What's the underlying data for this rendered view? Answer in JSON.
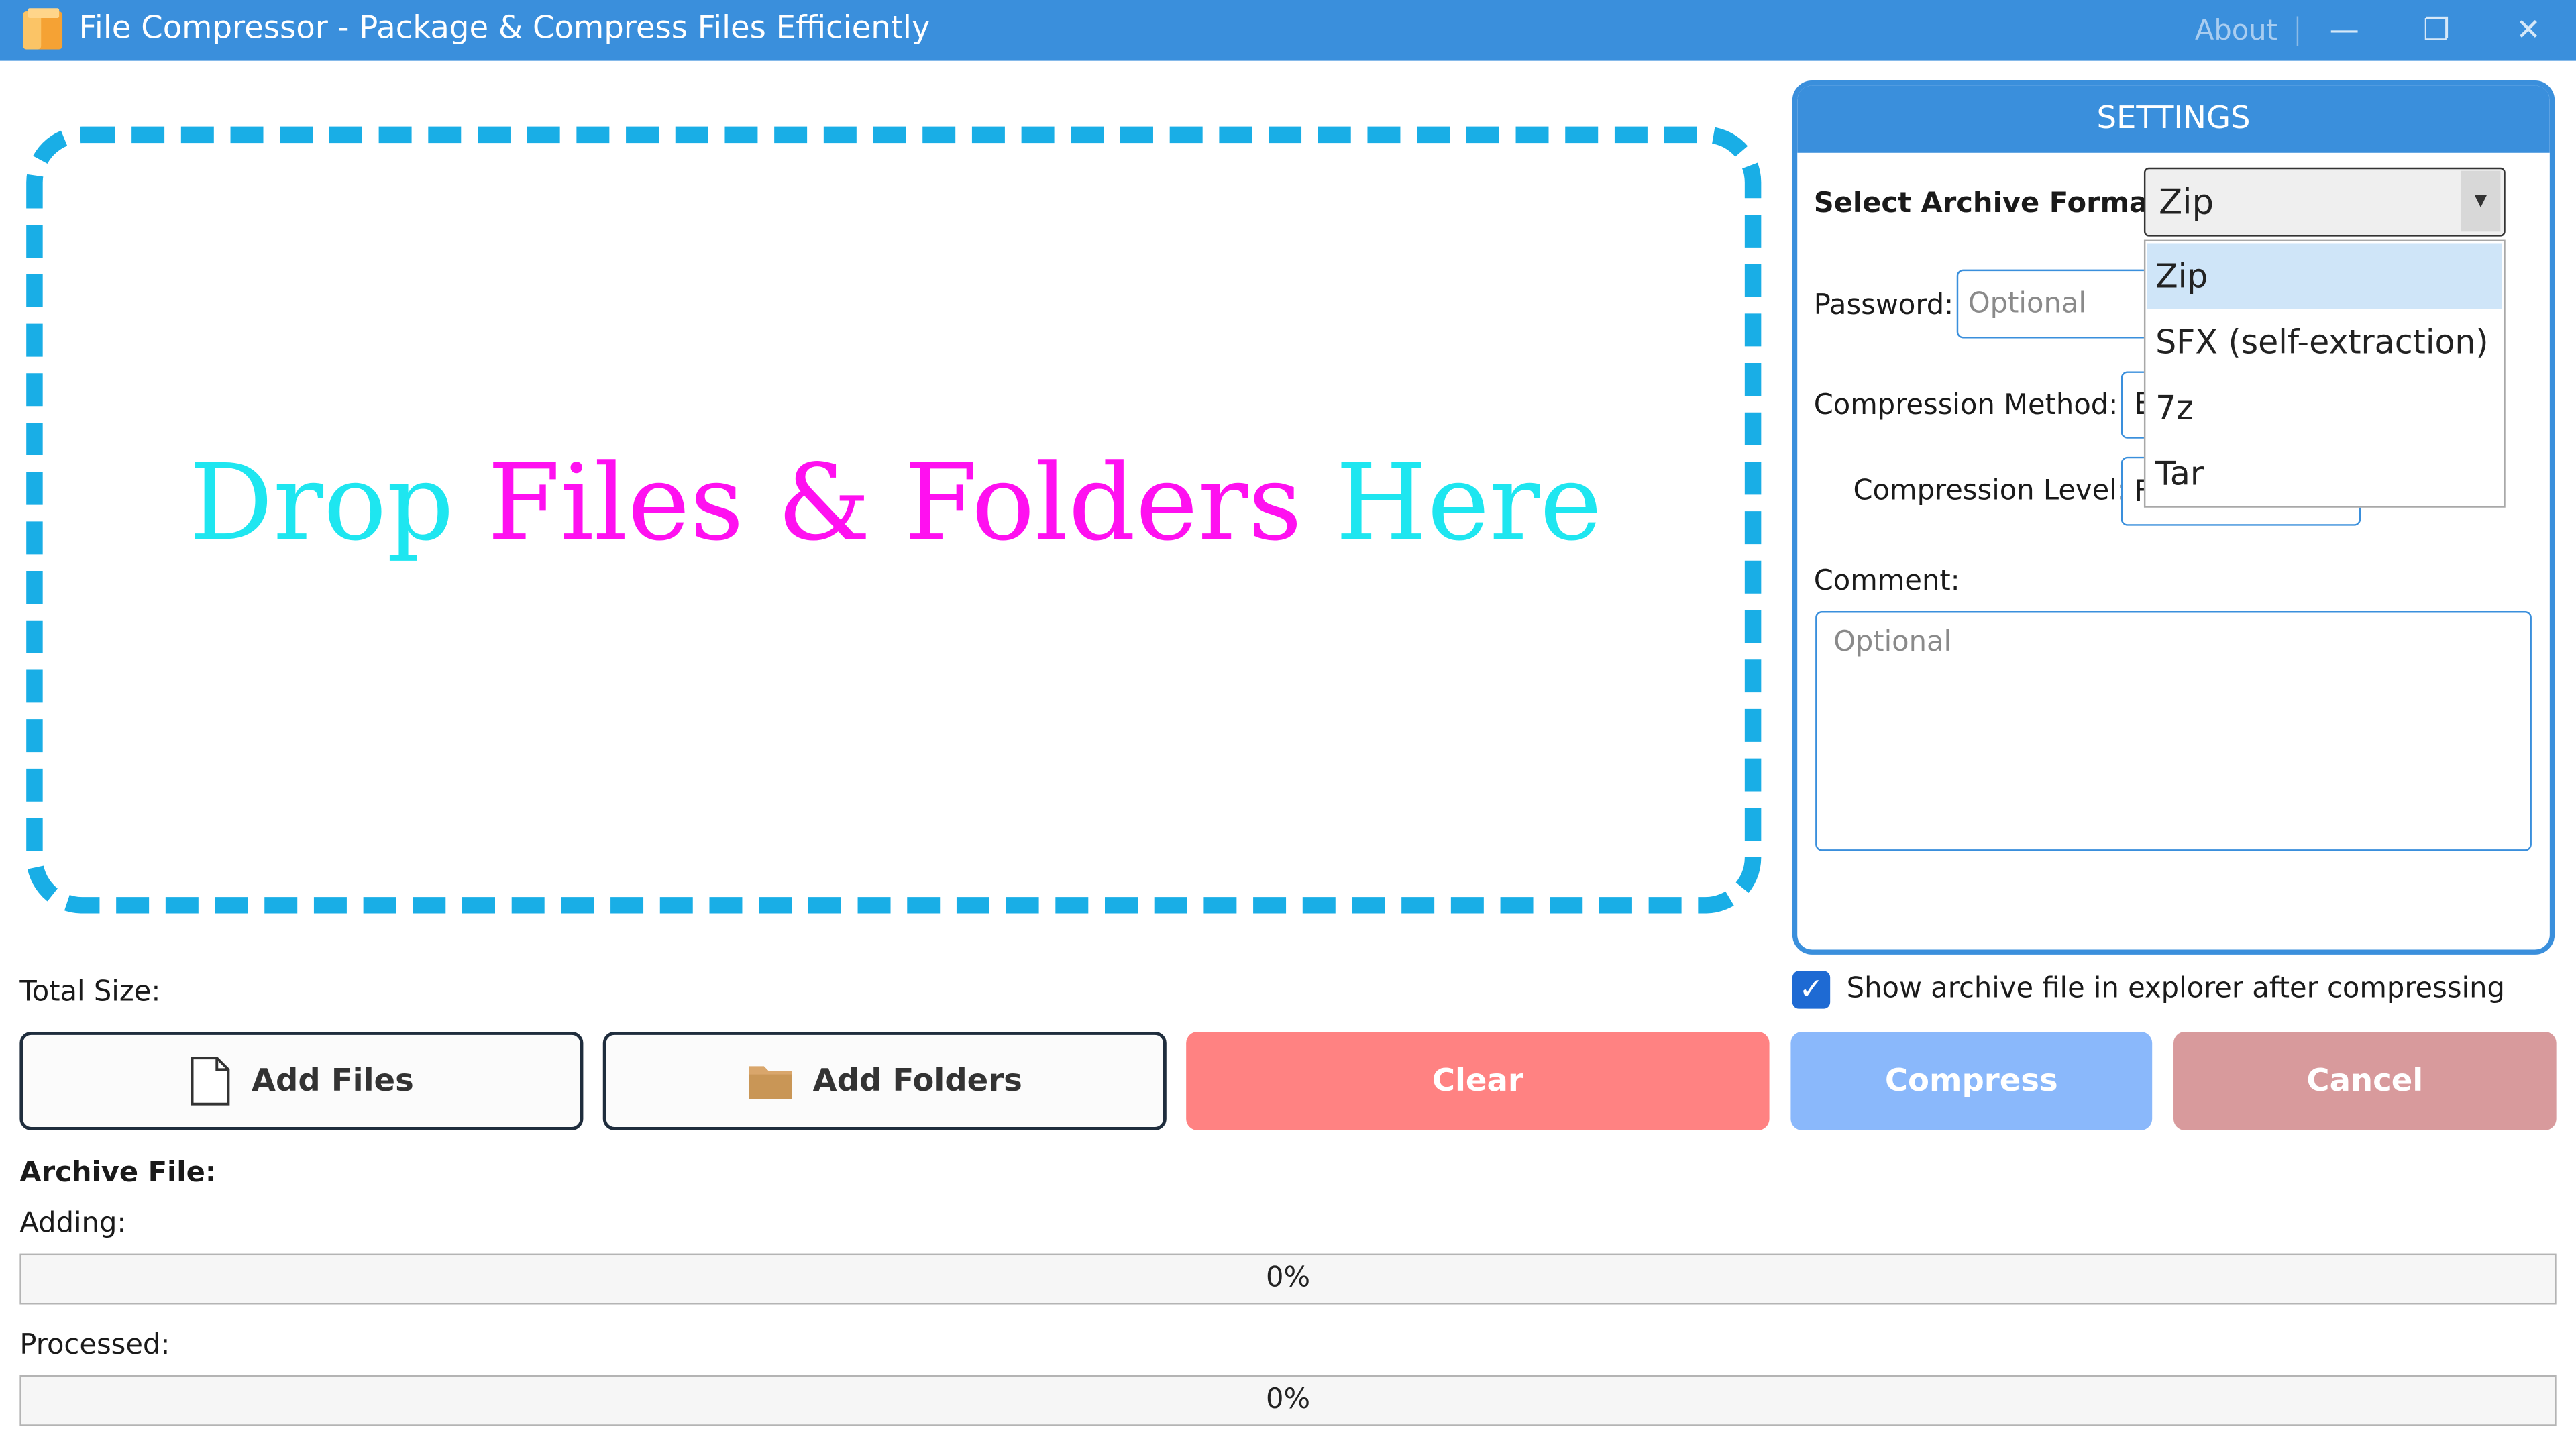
{
  "window": {
    "title": "File Compressor - Package & Compress Files Efficiently",
    "about_label": "About",
    "minimize_glyph": "—",
    "restore_glyph": "❐",
    "close_glyph": "✕"
  },
  "dropzone": {
    "text_part1": "Drop ",
    "text_part2": "Files & Folders",
    "text_part3": " Here"
  },
  "settings": {
    "header": "SETTINGS",
    "format_label": "Select Archive Format:",
    "format_value": "Zip",
    "format_options": [
      "Zip",
      "SFX (self-extraction)",
      "7z",
      "Tar"
    ],
    "format_selected_index": 0,
    "password_label": "Password:",
    "password_placeholder": "Optional",
    "method_label": "Compression Method:",
    "method_value_visible": "E",
    "level_label": "Compression Level:",
    "level_value_visible": "F",
    "comment_label": "Comment:",
    "comment_placeholder": "Optional"
  },
  "options": {
    "show_in_explorer_label": "Show archive file in explorer after compressing",
    "show_in_explorer_checked": true
  },
  "total_size_label": "Total Size:",
  "buttons": {
    "add_files": "Add Files",
    "add_folders": "Add Folders",
    "clear": "Clear",
    "compress": "Compress",
    "cancel": "Cancel"
  },
  "progress": {
    "archive_file_label": "Archive File:",
    "adding_label": "Adding:",
    "adding_text": "0%",
    "adding_value": 0,
    "processed_label": "Processed:",
    "processed_text": "0%",
    "processed_value": 0
  },
  "colors": {
    "titlebar": "#3a8fdc",
    "drop_border": "#19aee6",
    "drop_text_cyan": "#1ee6f0",
    "drop_text_magenta": "#ff10f0",
    "clear_button": "#ff8282",
    "compress_button": "#8ab8fb",
    "cancel_button": "#d89a9c"
  },
  "icons": {
    "app": "folder-archive-icon",
    "add_files": "file-icon",
    "add_folders": "folder-icon",
    "dropdown": "caret-down-icon",
    "checkbox": "checkmark-icon"
  }
}
